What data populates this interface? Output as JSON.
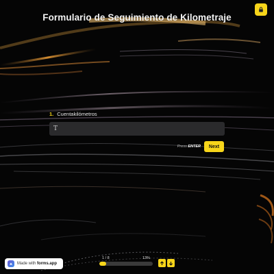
{
  "header": {
    "title": "Formulario de Seguimiento de Kilometraje",
    "lock_icon": "lock-icon"
  },
  "question": {
    "number": "1.",
    "label": "Cuentakilómetros",
    "input_value": "",
    "input_icon": "text-cursor-icon"
  },
  "actions": {
    "press_prefix": "Press",
    "press_key": "ENTER",
    "next_label": "Next"
  },
  "branding": {
    "made_with": "Made with",
    "brand": "forms.app"
  },
  "progress": {
    "current": "1 / 8",
    "percent_label": "13%",
    "fraction": 0.13
  },
  "navigation": {
    "up_icon": "arrow-up-icon",
    "down_icon": "arrow-down-icon"
  },
  "colors": {
    "accent": "#f7d51a",
    "background": "#050505",
    "input_bg": "#2a2a2c"
  }
}
